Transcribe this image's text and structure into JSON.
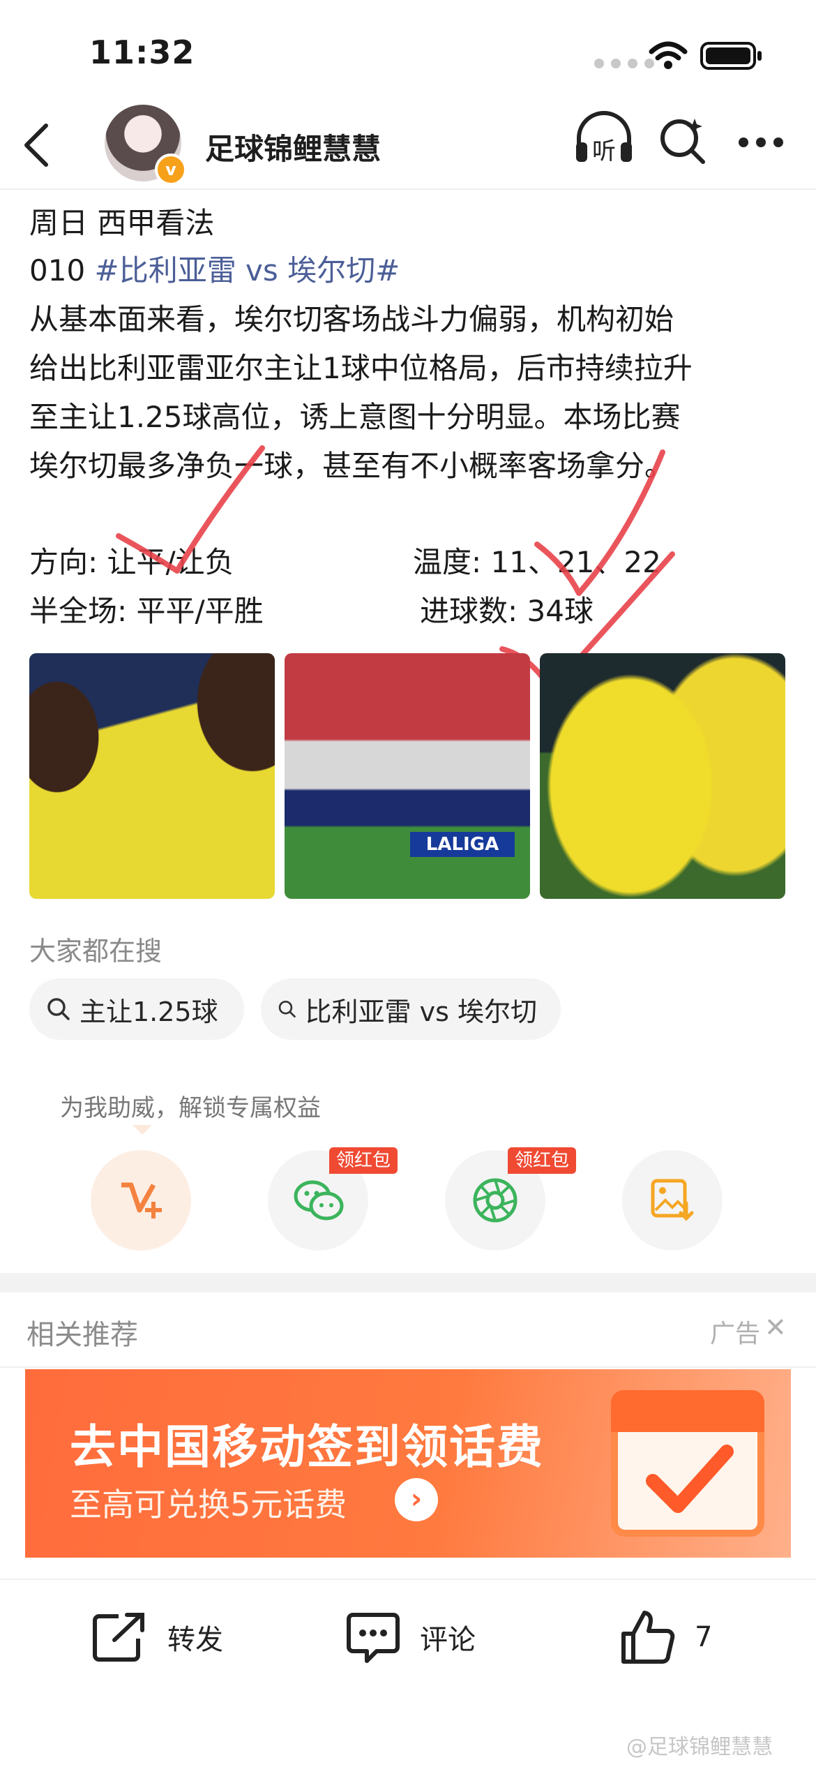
{
  "status_bar": {
    "time": "11:32"
  },
  "nav": {
    "title": "足球锦鲤慧慧",
    "listen_label": "听"
  },
  "post": {
    "line1": "周日 西甲看法",
    "line2_prefix": "010 ",
    "line2_topic": "#比利亚雷 vs 埃尔切#",
    "body_lines": [
      "从基本面来看，埃尔切客场战斗力偏弱，机构初始",
      "给出比利亚雷亚尔主让1球中位格局，后市持续拉升",
      "至主让1.25球高位，诱上意图十分明显。本场比赛",
      "埃尔切最多净负一球，甚至有不小概率客场拿分。"
    ],
    "direction": "方向: 让平/让负",
    "temperature": "温度: 11、21、22",
    "half_full": "半全场: 平平/平胜",
    "goals": "进球数: 34球"
  },
  "images": {
    "laliga_text": "LALIGA"
  },
  "search_section": {
    "title": "大家都在搜",
    "chips": [
      "主让1.25球",
      "比利亚雷 vs 埃尔切"
    ]
  },
  "support": {
    "tip": "为我助威，解锁专属权益",
    "badge1": "领红包",
    "badge2": "领红包"
  },
  "related": {
    "title": "相关推荐",
    "ad_label": "广告",
    "ad_close": "✕",
    "banner_title": "去中国移动签到领话费",
    "banner_subtitle": "至高可兑换5元话费"
  },
  "actions": {
    "share_label": "转发",
    "comment_label": "评论",
    "like_count": "7"
  },
  "watermark": "@足球锦鲤慧慧",
  "colors": {
    "topic": "#4b5e97",
    "accent": "#ff6c3c",
    "badge": "#f04a33",
    "checkmark": "#e8424a"
  }
}
